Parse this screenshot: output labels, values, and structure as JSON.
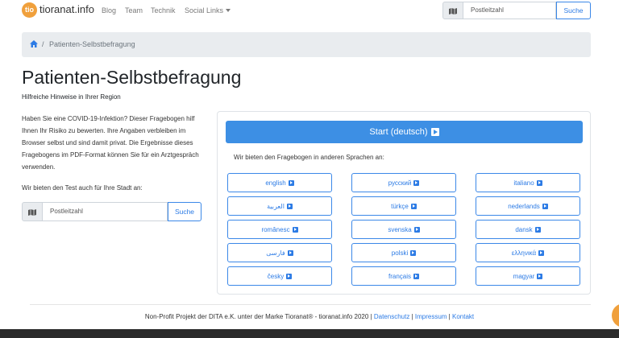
{
  "nav": {
    "logo_text": "tio",
    "brand": "tioranat.info",
    "links": [
      "Blog",
      "Team",
      "Technik",
      "Social Links"
    ],
    "search_placeholder": "Postleitzahl",
    "search_button": "Suche"
  },
  "breadcrumb": {
    "separator": "/",
    "current": "Patienten-Selbstbefragung"
  },
  "page": {
    "title": "Patienten-Selbstbefragung",
    "subtitle": "Hilfreiche Hinweise in Ihrer Region",
    "intro": "Haben Sie eine COVID-19-Infektion? Dieser Fragebogen hilf Ihnen Ihr Risiko zu bewerten. Ihre Angaben verbleiben im Browser selbst und sind damit privat. Die Ergebnisse dieses Fragebogens im PDF-Format können Sie für ein Arztgespräch verwenden.",
    "city_label": "Wir bieten den Test auch für Ihre Stadt an:",
    "city_placeholder": "Postleitzahl",
    "city_button": "Suche"
  },
  "card": {
    "start_label": "Start (deutsch)",
    "languages_intro": "Wir bieten den Fragebogen in anderen Sprachen an:",
    "languages": [
      "english",
      "русский",
      "italiano",
      "العربية",
      "türkçe",
      "nederlands",
      "românesc",
      "svenska",
      "dansk",
      "فارسی",
      "polski",
      "ελληνικά",
      "česky",
      "français",
      "magyar"
    ]
  },
  "footer": {
    "text": "Non-Profit Projekt der DITA e.K. unter der Marke Tioranat® - tioranat.info 2020",
    "sep": "|",
    "links": [
      "Datenschutz",
      "Impressum",
      "Kontakt"
    ]
  },
  "colors": {
    "primary": "#3d8fe4",
    "link": "#2c7be5",
    "brand_orange": "#f0a03c",
    "breadcrumb_bg": "#e9ecef"
  }
}
